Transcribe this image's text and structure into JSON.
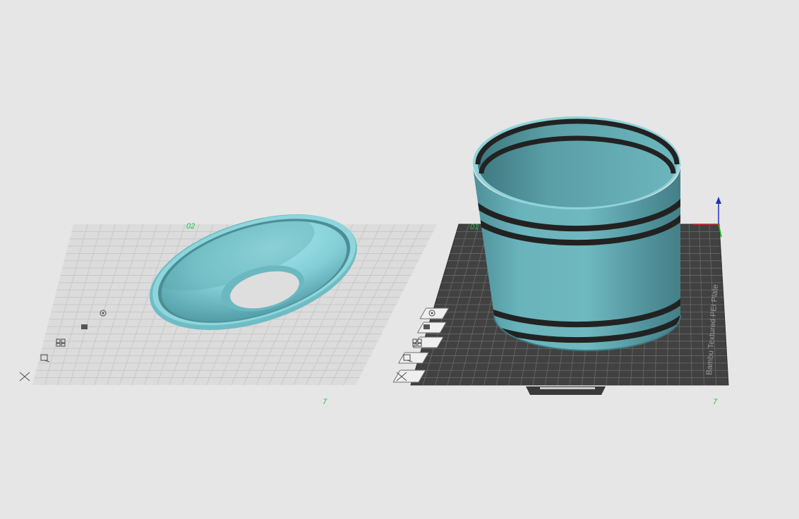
{
  "plates": [
    {
      "number_label": "02",
      "corner_mark": "7",
      "style": "light",
      "object": "funnel",
      "tools": [
        "auto-orient-icon",
        "lock-icon",
        "arrange-icon",
        "settings-icon",
        "delete-icon"
      ]
    },
    {
      "number_label": "01",
      "corner_mark": "7",
      "style": "textured-pei",
      "brand_text": "Bambu Textured PEI Plate",
      "object": "ringed-cylinder",
      "tools": [
        "auto-orient-icon",
        "lock-icon",
        "arrange-icon",
        "settings-icon",
        "delete-icon"
      ]
    }
  ],
  "colors": {
    "background": "#e6e6e6",
    "model": "#7dc9cf",
    "stripe": "#232323",
    "plate_dark": "#3f3f3f",
    "plate_light": "#dcdcdc",
    "axis_x": "#d42020",
    "axis_y": "#1ab51a",
    "axis_z": "#2030c8",
    "label_green": "#19c04a"
  }
}
